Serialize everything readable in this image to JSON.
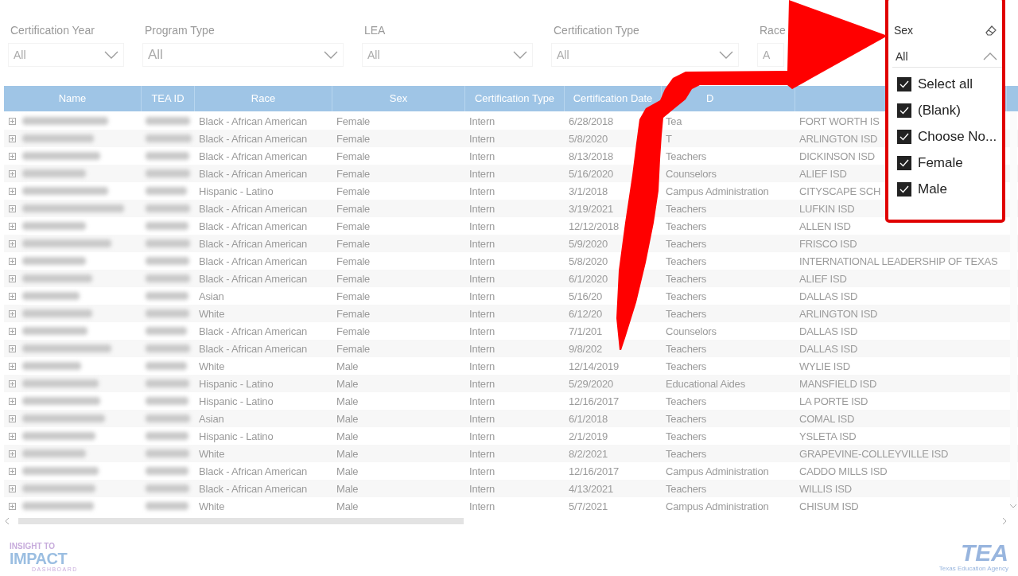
{
  "filters": [
    {
      "label": "Certification Year",
      "value": "All"
    },
    {
      "label": "Program Type",
      "value": "All"
    },
    {
      "label": "LEA",
      "value": "All"
    },
    {
      "label": "Certification Type",
      "value": "All"
    },
    {
      "label": "Race",
      "value": "A"
    }
  ],
  "sex_slicer": {
    "title": "Sex",
    "value": "All",
    "expanded": true,
    "options": [
      {
        "label": "Select all",
        "checked": true
      },
      {
        "label": "(Blank)",
        "checked": true
      },
      {
        "label": "Choose No...",
        "checked": true
      },
      {
        "label": "Female",
        "checked": true
      },
      {
        "label": "Male",
        "checked": true
      }
    ]
  },
  "table": {
    "columns": [
      "Name",
      "TEA ID",
      "Race",
      "Sex",
      "Certification Type",
      "Certification Date",
      "D"
    ],
    "rows": [
      {
        "race": "Black - African American",
        "sex": "Female",
        "certification_type": "Intern",
        "certification_date": "6/28/2018",
        "column_7": "Tea",
        "column_8": "FORT WORTH IS"
      },
      {
        "race": "Black - African American",
        "sex": "Female",
        "certification_type": "Intern",
        "certification_date": "5/8/2020",
        "column_7": "T",
        "column_8": "ARLINGTON ISD"
      },
      {
        "race": "Black - African American",
        "sex": "Female",
        "certification_type": "Intern",
        "certification_date": "8/13/2018",
        "column_7": "Teachers",
        "column_8": "DICKINSON ISD"
      },
      {
        "race": "Black - African American",
        "sex": "Female",
        "certification_type": "Intern",
        "certification_date": "5/16/2020",
        "column_7": "Counselors",
        "column_8": "ALIEF ISD"
      },
      {
        "race": "Hispanic - Latino",
        "sex": "Female",
        "certification_type": "Intern",
        "certification_date": "3/1/2018",
        "column_7": "Campus Administration",
        "column_8": "CITYSCAPE SCH"
      },
      {
        "race": "Black - African American",
        "sex": "Female",
        "certification_type": "Intern",
        "certification_date": "3/19/2021",
        "column_7": "Teachers",
        "column_8": "LUFKIN ISD"
      },
      {
        "race": "Black - African American",
        "sex": "Female",
        "certification_type": "Intern",
        "certification_date": "12/12/2018",
        "column_7": "Teachers",
        "column_8": "ALLEN ISD"
      },
      {
        "race": "Black - African American",
        "sex": "Female",
        "certification_type": "Intern",
        "certification_date": "5/9/2020",
        "column_7": "Teachers",
        "column_8": "FRISCO ISD"
      },
      {
        "race": "Black - African American",
        "sex": "Female",
        "certification_type": "Intern",
        "certification_date": "5/8/2020",
        "column_7": "Teachers",
        "column_8": "INTERNATIONAL LEADERSHIP OF TEXAS"
      },
      {
        "race": "Black - African American",
        "sex": "Female",
        "certification_type": "Intern",
        "certification_date": "6/1/2020",
        "column_7": "Teachers",
        "column_8": "ALIEF ISD"
      },
      {
        "race": "Asian",
        "sex": "Female",
        "certification_type": "Intern",
        "certification_date": "5/16/20",
        "column_7": "Teachers",
        "column_8": "DALLAS ISD"
      },
      {
        "race": "White",
        "sex": "Female",
        "certification_type": "Intern",
        "certification_date": "6/12/20",
        "column_7": "Teachers",
        "column_8": "ARLINGTON ISD"
      },
      {
        "race": "Black - African American",
        "sex": "Female",
        "certification_type": "Intern",
        "certification_date": "7/1/201",
        "column_7": "Counselors",
        "column_8": "DALLAS ISD"
      },
      {
        "race": "Black - African American",
        "sex": "Female",
        "certification_type": "Intern",
        "certification_date": "9/8/202",
        "column_7": "Teachers",
        "column_8": "DALLAS ISD"
      },
      {
        "race": "White",
        "sex": "Male",
        "certification_type": "Intern",
        "certification_date": "12/14/2019",
        "column_7": "Teachers",
        "column_8": "WYLIE ISD"
      },
      {
        "race": "Hispanic - Latino",
        "sex": "Male",
        "certification_type": "Intern",
        "certification_date": "5/29/2020",
        "column_7": "Educational Aides",
        "column_8": "MANSFIELD ISD"
      },
      {
        "race": "Hispanic - Latino",
        "sex": "Male",
        "certification_type": "Intern",
        "certification_date": "12/16/2017",
        "column_7": "Teachers",
        "column_8": "LA PORTE ISD"
      },
      {
        "race": "Asian",
        "sex": "Male",
        "certification_type": "Intern",
        "certification_date": "6/1/2018",
        "column_7": "Teachers",
        "column_8": "COMAL ISD"
      },
      {
        "race": "Hispanic - Latino",
        "sex": "Male",
        "certification_type": "Intern",
        "certification_date": "2/1/2019",
        "column_7": "Teachers",
        "column_8": "YSLETA ISD"
      },
      {
        "race": "White",
        "sex": "Male",
        "certification_type": "Intern",
        "certification_date": "8/2/2021",
        "column_7": "Teachers",
        "column_8": "GRAPEVINE-COLLEYVILLE ISD"
      },
      {
        "race": "Black - African American",
        "sex": "Male",
        "certification_type": "Intern",
        "certification_date": "12/16/2017",
        "column_7": "Campus Administration",
        "column_8": "CADDO MILLS ISD"
      },
      {
        "race": "Black - African American",
        "sex": "Male",
        "certification_type": "Intern",
        "certification_date": "4/13/2021",
        "column_7": "Teachers",
        "column_8": "WILLIS ISD"
      },
      {
        "race": "White",
        "sex": "Male",
        "certification_type": "Intern",
        "certification_date": "5/7/2021",
        "column_7": "Campus Administration",
        "column_8": "CHISUM ISD"
      }
    ]
  },
  "footer": {
    "left_logo": {
      "line_1": "INSIGHT TO",
      "line_2": "IMPACT",
      "line_3": "DASHBOARD"
    },
    "right_logo": {
      "mark": "TEA",
      "caption": "Texas Education Agency"
    }
  }
}
